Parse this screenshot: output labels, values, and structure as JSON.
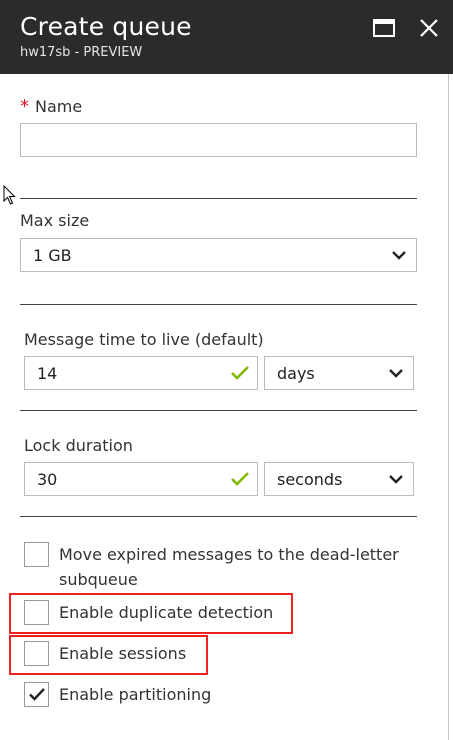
{
  "header": {
    "title": "Create queue",
    "subtitle": "hw17sb - PREVIEW"
  },
  "name": {
    "required_marker": "*",
    "label": "Name",
    "value": ""
  },
  "max_size": {
    "label": "Max size",
    "selected": "1 GB"
  },
  "message_ttl": {
    "label": "Message time to live (default)",
    "value": "14",
    "unit": "days"
  },
  "lock_duration": {
    "label": "Lock duration",
    "value": "30",
    "unit": "seconds"
  },
  "checkboxes": [
    {
      "label": "Move expired messages to the dead-letter subqueue",
      "checked": false
    },
    {
      "label": "Enable duplicate detection",
      "checked": false
    },
    {
      "label": "Enable sessions",
      "checked": false
    },
    {
      "label": "Enable partitioning",
      "checked": true
    }
  ],
  "colors": {
    "header_bg": "#2b2b2b",
    "valid_check": "#7fba00",
    "required": "#e81123",
    "highlight": "#e22222"
  }
}
